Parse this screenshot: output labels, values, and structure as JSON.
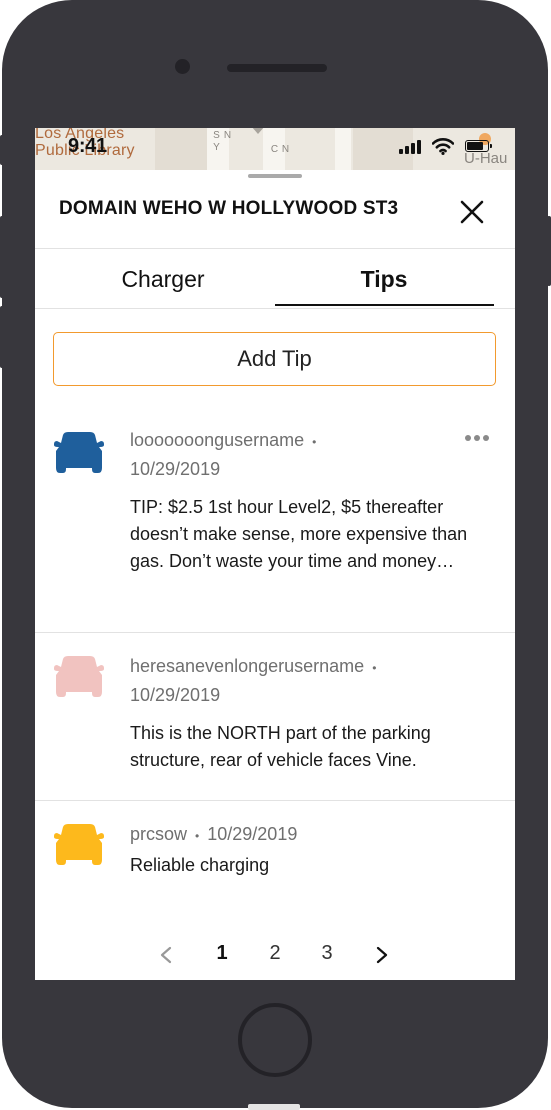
{
  "status": {
    "time": "9:41"
  },
  "map": {
    "poi_label": "Los Angeles\nPublic Library",
    "street_1": "N SY",
    "street_2": "N C",
    "uhaul": "U-Hau"
  },
  "sheet": {
    "title": "DOMAIN WEHO W HOLLYWOOD ST3"
  },
  "tabs": [
    {
      "label": "Charger",
      "selected": false
    },
    {
      "label": "Tips",
      "selected": true
    }
  ],
  "add_tip_label": "Add Tip",
  "tips": [
    {
      "username": "looooooongusername",
      "separator": "•",
      "date": "10/29/2019",
      "text": "TIP: $2.5 1st hour Level2, $5 thereafter doesn’t make sense, more expensive than gas. Don’t waste your time and money…",
      "car_color": "#1f5f9c",
      "icon": "car-icon"
    },
    {
      "username": "heresanevenlongerusername",
      "separator": "•",
      "date": "10/29/2019",
      "text": "This is the NORTH part of the parking structure, rear of vehicle faces Vine.",
      "car_color": "#f1c3c0",
      "icon": "car-icon"
    },
    {
      "username": "prcsow",
      "separator": "•",
      "date": "10/29/2019",
      "text": "Reliable charging",
      "car_color": "#fdb91c",
      "icon": "car-icon"
    }
  ],
  "pagination": {
    "pages": [
      "1",
      "2",
      "3"
    ],
    "current": "1",
    "prev_icon": "chevron-left-icon",
    "next_icon": "chevron-right-icon"
  },
  "colors": {
    "accent": "#f29a2e",
    "frame": "#38373d"
  }
}
